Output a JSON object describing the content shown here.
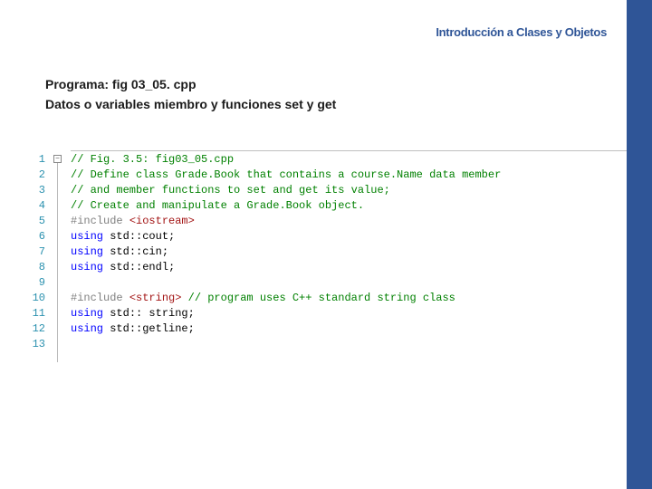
{
  "header": {
    "title": "Introducción a Clases y Objetos"
  },
  "program": {
    "label": "Programa: fig 03_05. cpp",
    "desc": "Datos o variables miembro y funciones set y get"
  },
  "code": {
    "line1_comment": "// Fig. 3.5: fig03_05.cpp",
    "line2_comment": "// Define class Grade.Book that contains a course.Name data member",
    "line3_comment": "// and member functions to set and get its value;",
    "line4_comment": "// Create and manipulate a Grade.Book object.",
    "line5_pp": "#include",
    "line5_inc": "<iostream>",
    "line6_kw": "using",
    "line6_rest": " std::cout;",
    "line7_kw": "using",
    "line7_rest": " std::cin;",
    "line8_kw": "using",
    "line8_rest": " std::endl;",
    "line10_pp": "#include",
    "line10_inc": "<string>",
    "line10_comment": " // program uses C++ standard string class",
    "line11_kw": "using",
    "line11_rest": " std:: string;",
    "line12_kw": "using",
    "line12_rest": " std::getline;",
    "nums": [
      "1",
      "2",
      "3",
      "4",
      "5",
      "6",
      "7",
      "8",
      "9",
      "10",
      "11",
      "12",
      "13"
    ]
  },
  "icons": {
    "fold": "−"
  }
}
